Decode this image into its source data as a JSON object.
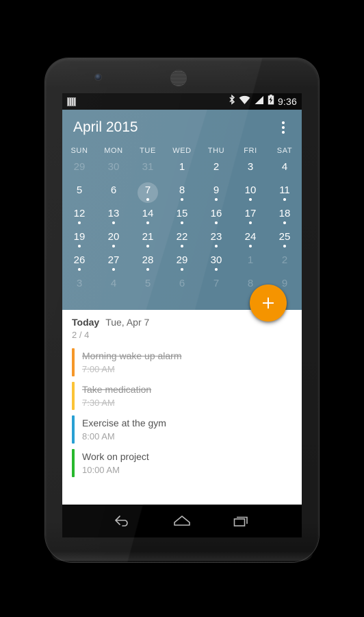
{
  "status_bar": {
    "notification_icon": "barcode-notification-icon",
    "bluetooth_icon": "bluetooth-icon",
    "wifi_icon": "wifi-icon",
    "signal_icon": "cellular-signal-icon",
    "battery_icon": "battery-charging-icon",
    "clock": "9:36"
  },
  "toolbar": {
    "title": "April 2015",
    "overflow_label": "overflow-menu"
  },
  "calendar": {
    "weekdays": [
      "SUN",
      "MON",
      "TUE",
      "WED",
      "THU",
      "FRI",
      "SAT"
    ],
    "selected_day": 7,
    "accent_color": "#5b8296",
    "days": [
      {
        "n": "29",
        "muted": true,
        "dot": false
      },
      {
        "n": "30",
        "muted": true,
        "dot": false
      },
      {
        "n": "31",
        "muted": true,
        "dot": false
      },
      {
        "n": "1",
        "muted": false,
        "dot": false
      },
      {
        "n": "2",
        "muted": false,
        "dot": false
      },
      {
        "n": "3",
        "muted": false,
        "dot": false
      },
      {
        "n": "4",
        "muted": false,
        "dot": false
      },
      {
        "n": "5",
        "muted": false,
        "dot": false
      },
      {
        "n": "6",
        "muted": false,
        "dot": false
      },
      {
        "n": "7",
        "muted": false,
        "dot": true,
        "today": true
      },
      {
        "n": "8",
        "muted": false,
        "dot": true
      },
      {
        "n": "9",
        "muted": false,
        "dot": true
      },
      {
        "n": "10",
        "muted": false,
        "dot": true
      },
      {
        "n": "11",
        "muted": false,
        "dot": true
      },
      {
        "n": "12",
        "muted": false,
        "dot": true
      },
      {
        "n": "13",
        "muted": false,
        "dot": true
      },
      {
        "n": "14",
        "muted": false,
        "dot": true
      },
      {
        "n": "15",
        "muted": false,
        "dot": true
      },
      {
        "n": "16",
        "muted": false,
        "dot": true
      },
      {
        "n": "17",
        "muted": false,
        "dot": true
      },
      {
        "n": "18",
        "muted": false,
        "dot": true
      },
      {
        "n": "19",
        "muted": false,
        "dot": true
      },
      {
        "n": "20",
        "muted": false,
        "dot": true
      },
      {
        "n": "21",
        "muted": false,
        "dot": true
      },
      {
        "n": "22",
        "muted": false,
        "dot": true
      },
      {
        "n": "23",
        "muted": false,
        "dot": true
      },
      {
        "n": "24",
        "muted": false,
        "dot": true
      },
      {
        "n": "25",
        "muted": false,
        "dot": true
      },
      {
        "n": "26",
        "muted": false,
        "dot": true
      },
      {
        "n": "27",
        "muted": false,
        "dot": true
      },
      {
        "n": "28",
        "muted": false,
        "dot": true
      },
      {
        "n": "29",
        "muted": false,
        "dot": true
      },
      {
        "n": "30",
        "muted": false,
        "dot": true
      },
      {
        "n": "1",
        "muted": true,
        "dot": false
      },
      {
        "n": "2",
        "muted": true,
        "dot": false
      },
      {
        "n": "3",
        "muted": true,
        "dot": false
      },
      {
        "n": "4",
        "muted": true,
        "dot": false
      },
      {
        "n": "5",
        "muted": true,
        "dot": false
      },
      {
        "n": "6",
        "muted": true,
        "dot": false
      },
      {
        "n": "7",
        "muted": true,
        "dot": false
      },
      {
        "n": "8",
        "muted": true,
        "dot": false
      },
      {
        "n": "9",
        "muted": true,
        "dot": false
      }
    ]
  },
  "fab": {
    "icon": "plus-icon",
    "color": "#f59400"
  },
  "events": {
    "today_label": "Today",
    "date_label": "Tue, Apr 7",
    "count_label": "2 / 4",
    "items": [
      {
        "title": "Morning wake up alarm",
        "time": "7:00 AM",
        "color": "#f5921e",
        "done": true
      },
      {
        "title": "Take medication",
        "time": "7:30 AM",
        "color": "#fbc02d",
        "done": true
      },
      {
        "title": "Exercise at the gym",
        "time": "8:00 AM",
        "color": "#1e9bd1",
        "done": false
      },
      {
        "title": "Work on project",
        "time": "10:00 AM",
        "color": "#1db424",
        "done": false
      }
    ]
  },
  "nav_bar": {
    "back": "back-icon",
    "home": "home-icon",
    "recents": "recents-icon"
  }
}
